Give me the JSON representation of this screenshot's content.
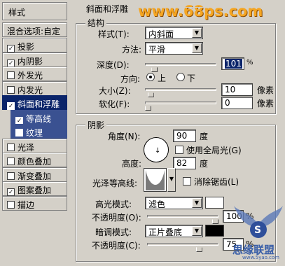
{
  "watermark_top": "www.68ps.com",
  "watermark_bottom": "思缘联盟",
  "watermark_bottom_url": "www.5yao.com",
  "style_list": {
    "header": "样式",
    "blend_options": "混合选项:自定",
    "items": [
      {
        "label": "投影",
        "checked": true
      },
      {
        "label": "内阴影",
        "checked": true
      },
      {
        "label": "外发光",
        "checked": false
      },
      {
        "label": "内发光",
        "checked": false
      },
      {
        "label": "斜面和浮雕",
        "checked": true
      },
      {
        "label": "等高线",
        "checked": true
      },
      {
        "label": "纹理",
        "checked": false
      },
      {
        "label": "光泽",
        "checked": false
      },
      {
        "label": "颜色叠加",
        "checked": false
      },
      {
        "label": "渐变叠加",
        "checked": false
      },
      {
        "label": "图案叠加",
        "checked": true
      },
      {
        "label": "描边",
        "checked": false
      }
    ],
    "check_mark": "✓"
  },
  "bevel": {
    "title": "斜面和浮雕",
    "structure": {
      "title": "结构",
      "style_label": "样式(T):",
      "style_value": "内斜面",
      "method_label": "方法:",
      "method_value": "平滑",
      "depth_label": "深度(D):",
      "depth_value": "101",
      "depth_unit": "%",
      "depth_fraction": 0.1,
      "direction_label": "方向:",
      "direction_up": "上",
      "direction_down": "下",
      "size_label": "大小(Z):",
      "size_value": "10",
      "size_unit": "像素",
      "size_fraction": 0.04,
      "soften_label": "软化(F):",
      "soften_value": "0",
      "soften_unit": "像素",
      "soften_fraction": 0.0
    },
    "shading": {
      "title": "阴影",
      "angle_label": "角度(N):",
      "angle_value": "90",
      "angle_unit": "度",
      "global_light_label": "使用全局光(G)",
      "altitude_label": "高度:",
      "altitude_value": "82",
      "altitude_unit": "度",
      "gloss_contour_label": "光泽等高线:",
      "anti_aliased_label": "消除锯齿(L)",
      "highlight_mode_label": "高光模式:",
      "highlight_mode_value": "滤色",
      "highlight_color": "#ffffff",
      "highlight_opacity_label": "不透明度(O):",
      "highlight_opacity_value": "100",
      "highlight_opacity_fraction": 1.0,
      "shadow_mode_label": "暗调模式:",
      "shadow_mode_value": "正片叠底",
      "shadow_color": "#000000",
      "shadow_opacity_label": "不透明度(C):",
      "shadow_opacity_value": "75",
      "shadow_opacity_fraction": 0.75,
      "percent_unit": "%"
    }
  },
  "colors": {
    "panel_bg": "#d4d0c8",
    "selection_bg": "#0a246a",
    "watermark_orange": "#f5a623"
  }
}
